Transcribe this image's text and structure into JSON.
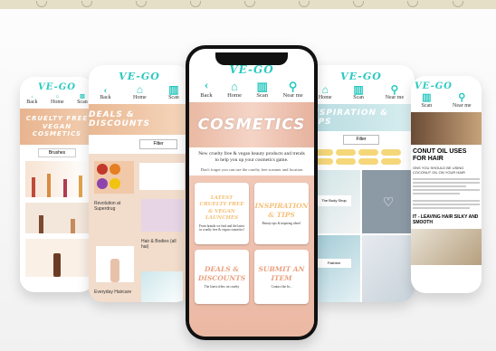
{
  "app": {
    "logo": "VE-GO"
  },
  "nav": {
    "back": "Back",
    "home": "Home",
    "scan": "Scan",
    "near_me": "Near me"
  },
  "cosmetics": {
    "hero_title": "COSMETICS",
    "intro": "New cruelty free & vegan beauty products and trends to help you up your cosmetics game.",
    "reminder": "Don't forget you can use the cruelty free scanner and location",
    "cards": [
      {
        "title": "LATEST CRUELTY FREE & VEGAN LAUNCHES",
        "desc": "From brands we find and the latest in cruelty free & vegan cosmetics!"
      },
      {
        "title": "INSPIRATION & TIPS",
        "desc": "Beauty tips & inspiring ideas!"
      },
      {
        "title": "DEALS & DISCOUNTS",
        "desc": "The latest offers on cruelty"
      },
      {
        "title": "SUBMIT AN ITEM",
        "desc": "Contact the br..."
      }
    ]
  },
  "deals": {
    "title": "DEALS & DISCOUNTS",
    "filter": "Filter",
    "items": [
      "Revolution at Superdrug",
      "Hair & Bodies (all hai)",
      "Everyday Haircare"
    ]
  },
  "cruelty": {
    "title": "CRUELTY FREE VEGAN COSMETICS",
    "filter": "Brushes"
  },
  "inspiration": {
    "title": "INSPIRATION & TIPS",
    "filter": "Filter",
    "tag": "The Body Shop",
    "caption": "Fashion"
  },
  "coconut": {
    "title": "CONUT OIL USES FOR HAIR",
    "subtitle": "ONS YOU SHOULD BE USING COCONUT OIL ON YOUR HAIR",
    "section": "IT - LEAVING HAIR SILKY AND SMOOTH"
  }
}
